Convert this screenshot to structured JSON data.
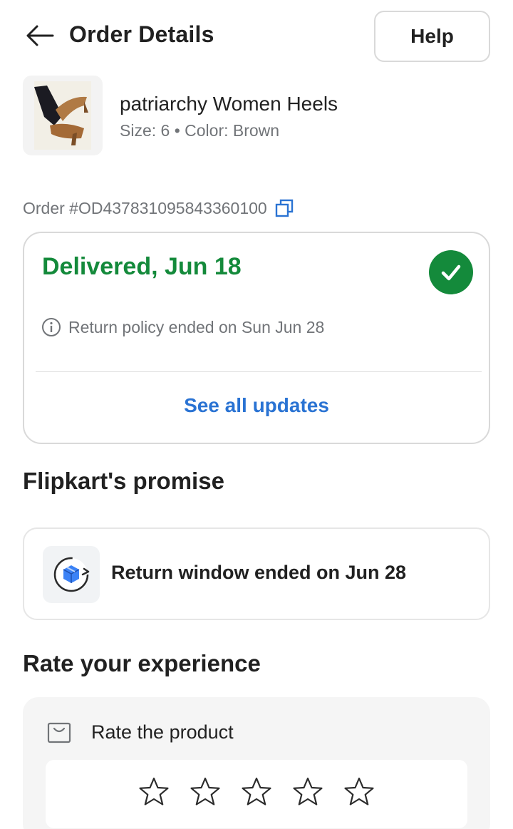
{
  "header": {
    "title": "Order Details",
    "back_icon": "arrow-left-icon",
    "help_label": "Help"
  },
  "product": {
    "name": "patriarchy Women Heels",
    "meta": "Size: 6 • Color: Brown",
    "image": "product-heels-image"
  },
  "order": {
    "id_text": "Order #OD437831095843360100",
    "copy_icon": "copy-icon"
  },
  "status": {
    "title": "Delivered, Jun 18",
    "check_icon": "check-circle-icon",
    "policy_text": "Return policy ended on Sun Jun 28",
    "info_icon": "info-icon",
    "see_all_label": "See all updates",
    "accent_color": "#148a3b",
    "link_color": "#2a73d3"
  },
  "promise": {
    "section_title": "Flipkart's promise",
    "icon": "return-box-icon",
    "text": "Return window ended on Jun 28"
  },
  "rate": {
    "section_title": "Rate your experience",
    "label": "Rate the product",
    "bag_icon": "bag-icon",
    "stars": {
      "filled": 0,
      "total": 5
    }
  }
}
